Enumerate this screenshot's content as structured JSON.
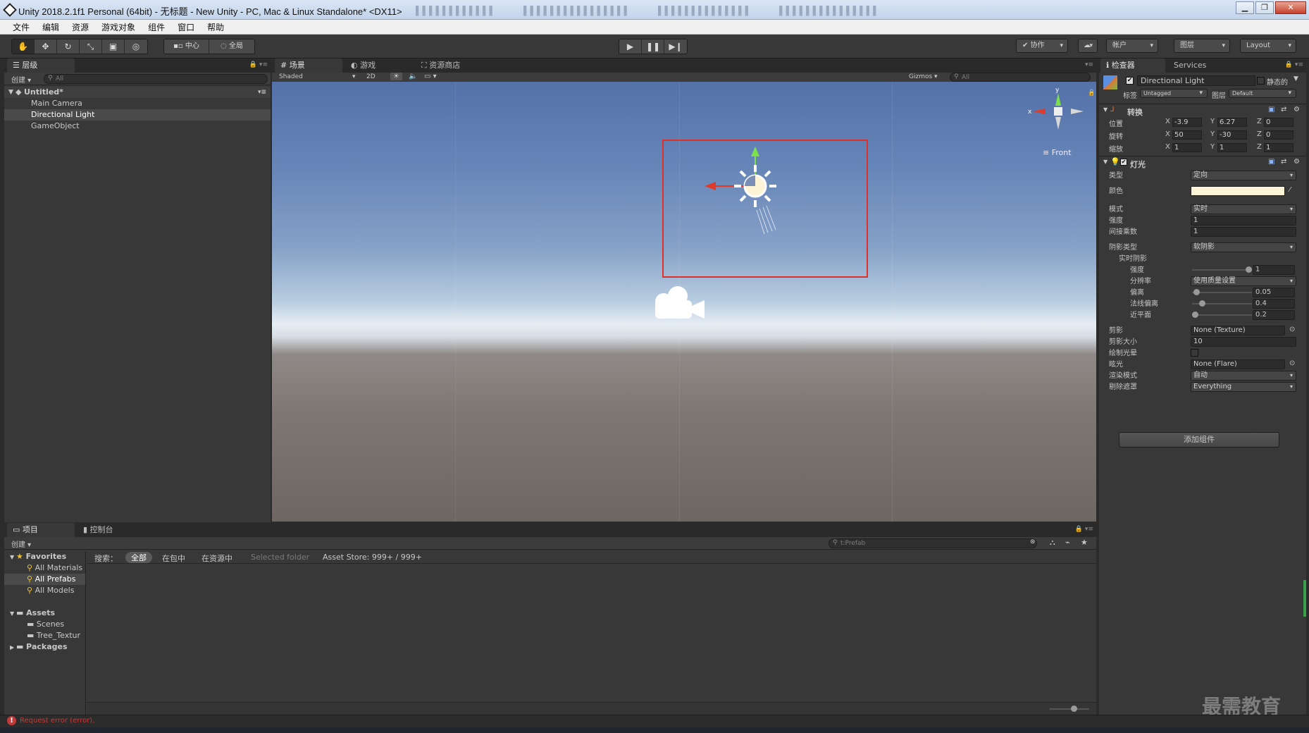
{
  "window": {
    "title": "Unity 2018.2.1f1 Personal (64bit) - 无标题 - New Unity - PC, Mac & Linux Standalone* <DX11>"
  },
  "menubar": [
    "文件",
    "编辑",
    "资源",
    "游戏对象",
    "组件",
    "窗口",
    "帮助"
  ],
  "toolbar": {
    "pivot": "中心",
    "space": "全局",
    "collab": "协作",
    "account": "帐户",
    "layers": "图层",
    "layout": "Layout"
  },
  "hierarchy": {
    "tab": "层级",
    "create": "创建",
    "search_placeholder": "All",
    "scene": "Untitled*",
    "items": [
      "Main Camera",
      "Directional Light",
      "GameObject"
    ]
  },
  "scene_tabs": {
    "scene": "场景",
    "game": "游戏",
    "asset_store": "资源商店"
  },
  "scene_toolbar": {
    "shading": "Shaded",
    "mode_2d": "2D",
    "gizmos": "Gizmos",
    "search_placeholder": "All"
  },
  "scene_gizmo": {
    "view_label": "Front",
    "axis_x": "x",
    "axis_y": "y"
  },
  "inspector": {
    "tab": "检查器",
    "services_tab": "Services",
    "object_name": "Directional Light",
    "static_label": "静态的",
    "tag_label": "标签",
    "tag_value": "Untagged",
    "layer_label": "图层",
    "layer_value": "Default",
    "transform": {
      "title": "转换",
      "position_label": "位置",
      "rotation_label": "旋转",
      "scale_label": "缩放",
      "position": {
        "x": "-3.9",
        "y": "6.27",
        "z": "0"
      },
      "rotation": {
        "x": "50",
        "y": "-30",
        "z": "0"
      },
      "scale": {
        "x": "1",
        "y": "1",
        "z": "1"
      }
    },
    "light": {
      "title": "灯光",
      "type_label": "类型",
      "type_value": "定向",
      "color_label": "颜色",
      "color_value": "#fff4d6",
      "mode_label": "模式",
      "mode_value": "实时",
      "intensity_label": "强度",
      "intensity_value": "1",
      "indirect_label": "间接乘数",
      "indirect_value": "1",
      "shadow_type_label": "阴影类型",
      "shadow_type_value": "软阴影",
      "realtime_shadows_label": "实时阴影",
      "strength_label": "强度",
      "strength_value": "1",
      "strength_fraction": 1.0,
      "resolution_label": "分辨率",
      "resolution_value": "使用质量设置",
      "bias_label": "偏离",
      "bias_value": "0.05",
      "bias_fraction": 0.025,
      "normal_bias_label": "法线偏离",
      "normal_bias_value": "0.4",
      "normal_bias_fraction": 0.13,
      "near_plane_label": "近平面",
      "near_plane_value": "0.2",
      "near_plane_fraction": 0.0,
      "cookie_label": "剪影",
      "cookie_value": "None (Texture)",
      "cookie_size_label": "剪影大小",
      "cookie_size_value": "10",
      "draw_halo_label": "绘制光晕",
      "flare_label": "眩光",
      "flare_value": "None (Flare)",
      "render_mode_label": "渲染模式",
      "render_mode_value": "自动",
      "culling_label": "剔除遮罩",
      "culling_value": "Everything"
    },
    "add_component": "添加组件"
  },
  "project": {
    "tab": "项目",
    "console_tab": "控制台",
    "create": "创建",
    "search_value": "t:Prefab",
    "favorites_label": "Favorites",
    "favorites": [
      "All Materials",
      "All Prefabs",
      "All Models"
    ],
    "assets_label": "Assets",
    "assets": [
      "Scenes",
      "Tree_Textur"
    ],
    "packages_label": "Packages",
    "search_bar": {
      "label": "搜索：",
      "all": "全部",
      "in_packages": "在包中",
      "in_assets": "在资源中",
      "selected_folder": "Selected folder",
      "asset_store": "Asset Store: 999+ / 999+"
    }
  },
  "status": {
    "error": "Request error (error)."
  },
  "watermark": "最需教育",
  "colors": {
    "highlight_box": "#e0302a",
    "error": "#c23a3a"
  }
}
